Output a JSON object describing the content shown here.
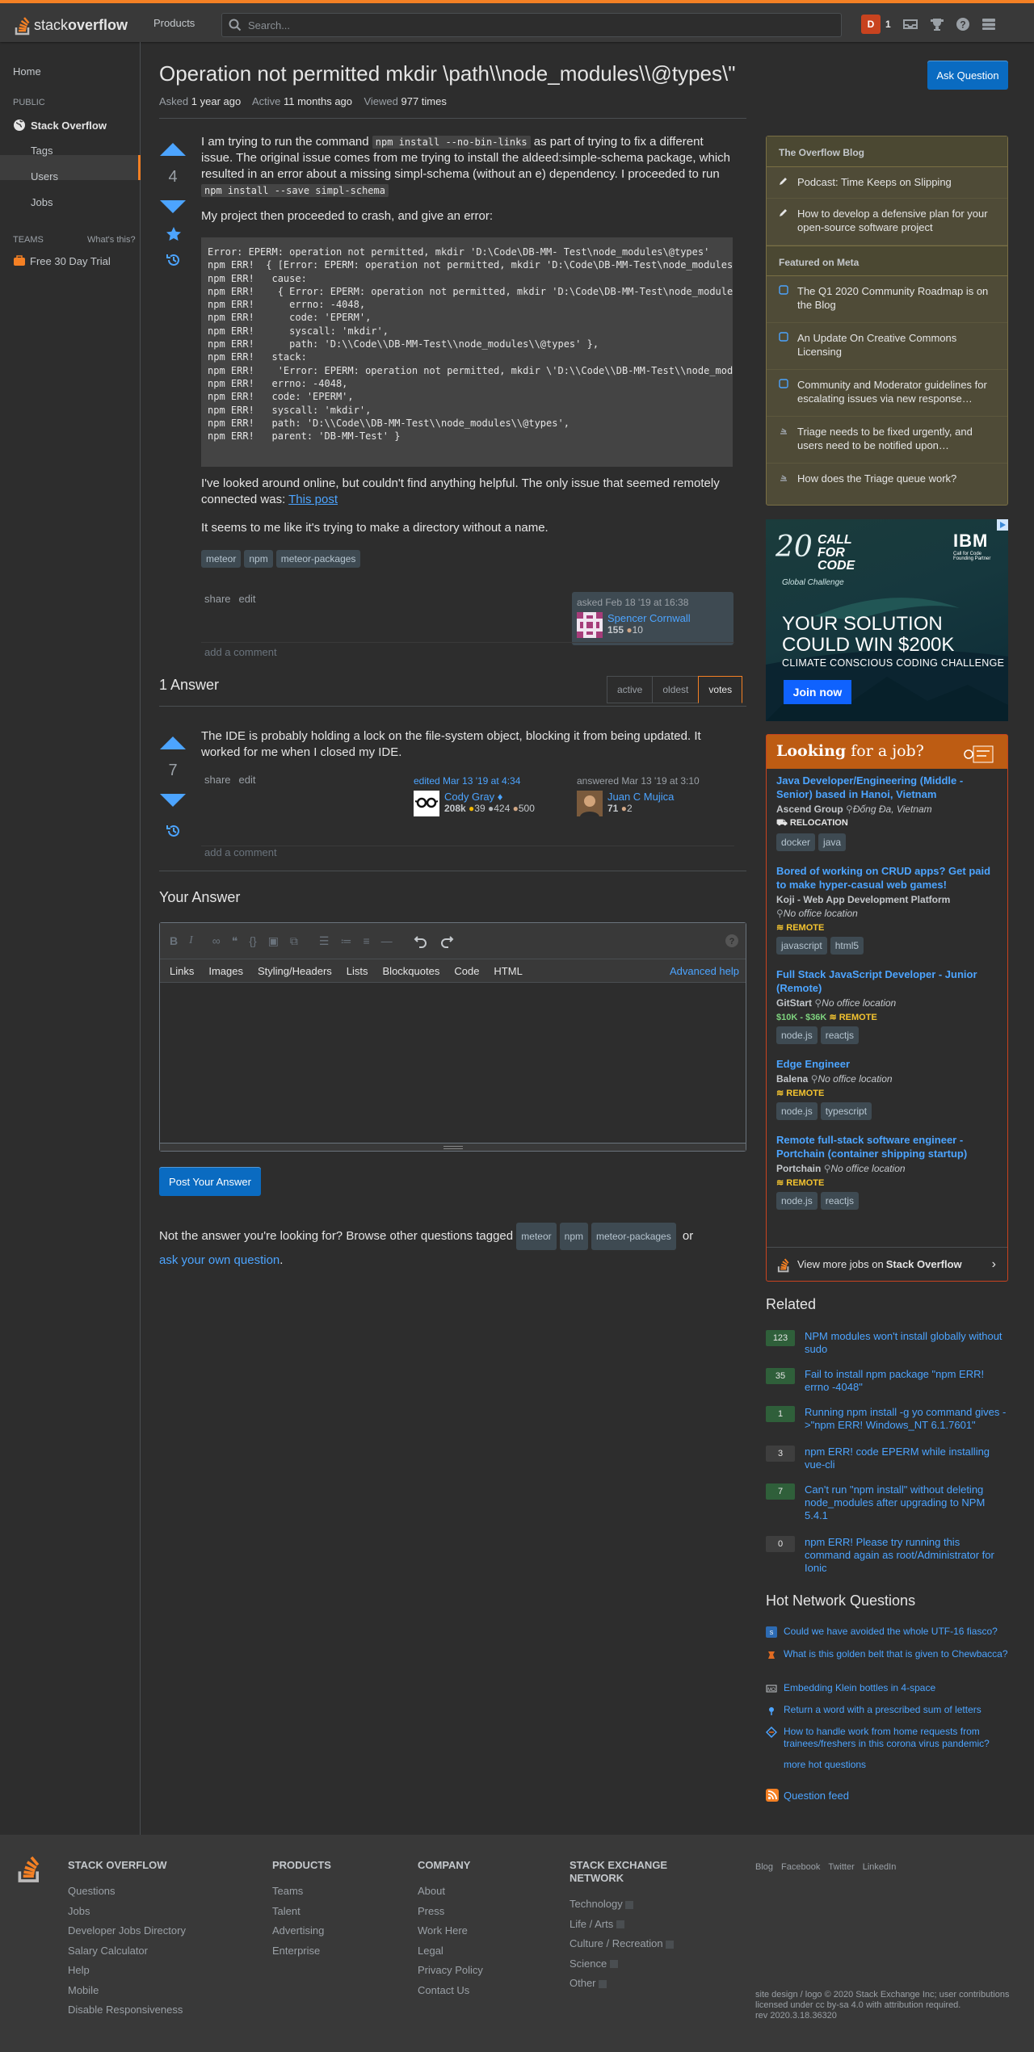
{
  "topbar": {
    "logo_text_light": "stack",
    "logo_text_bold": "overflow",
    "products": "Products",
    "search_placeholder": "Search...",
    "user_initial": "D",
    "rep": "1"
  },
  "sidebar": {
    "home": "Home",
    "public": "PUBLIC",
    "stackoverflow": "Stack Overflow",
    "tags": "Tags",
    "users": "Users",
    "jobs": "Jobs",
    "teams": "TEAMS",
    "whats_this": "What's this?",
    "free_trial": "Free 30 Day Trial"
  },
  "question": {
    "title": "Operation not permitted mkdir \\path\\\\node_modules\\\\@types\\\"",
    "ask_button": "Ask Question",
    "asked_label": "Asked",
    "asked_value": "1 year ago",
    "active_label": "Active",
    "active_value": "11 months ago",
    "viewed_label": "Viewed",
    "viewed_value": "977 times",
    "votes": "4",
    "p1_a": "I am trying to run the command ",
    "p1_code1": "npm install --no-bin-links",
    "p1_b": " as part of trying to fix a different issue. The original issue comes from me trying to install the aldeed:simple-schema package, which resulted in an error about a missing simpl-schema (without an e) dependency. I proceeded to run ",
    "p1_code2": "npm install --save simpl-schema",
    "p2": "My project then proceeded to crash, and give an error:",
    "code_block": "Error: EPERM: operation not permitted, mkdir 'D:\\Code\\DB-MM- Test\\node_modules\\@types'\nnpm ERR!  { [Error: EPERM: operation not permitted, mkdir 'D:\\Code\\DB-MM-Test\\node_modules\\\nnpm ERR!   cause:\nnpm ERR!    { Error: EPERM: operation not permitted, mkdir 'D:\\Code\\DB-MM-Test\\node_modules\nnpm ERR!      errno: -4048,\nnpm ERR!      code: 'EPERM',\nnpm ERR!      syscall: 'mkdir',\nnpm ERR!      path: 'D:\\\\Code\\\\DB-MM-Test\\\\node_modules\\\\@types' },\nnpm ERR!   stack:\nnpm ERR!    'Error: EPERM: operation not permitted, mkdir \\'D:\\\\Code\\\\DB-MM-Test\\\\node_modu\nnpm ERR!   errno: -4048,\nnpm ERR!   code: 'EPERM',\nnpm ERR!   syscall: 'mkdir',\nnpm ERR!   path: 'D:\\\\Code\\\\DB-MM-Test\\\\node_modules\\\\@types',\nnpm ERR!   parent: 'DB-MM-Test' }",
    "p3_a": "I've looked around online, but couldn't find anything helpful. The only issue that seemed remotely connected was: ",
    "p3_link": "This post",
    "p4": "It seems to me like it's trying to make a directory without a name.",
    "tags": [
      "meteor",
      "npm",
      "meteor-packages"
    ],
    "share": "share",
    "edit": "edit",
    "asked_card": "asked Feb 18 '19 at 16:38",
    "owner_name": "Spencer Cornwall",
    "owner_rep": "155",
    "owner_bronze": "10",
    "add_comment": "add a comment"
  },
  "answers": {
    "count_label": "1 Answer",
    "tabs": [
      "active",
      "oldest",
      "votes"
    ],
    "votes": "7",
    "body": "The IDE is probably holding a lock on the file-system object, blocking it from being updated. It worked for me when I closed my IDE.",
    "share": "share",
    "edit": "edit",
    "edited": "edited Mar 13 '19 at 4:34",
    "editor_name": "Cody Gray ♦",
    "editor_rep": "208k",
    "editor_gold": "39",
    "editor_silver": "424",
    "editor_bronze": "500",
    "answered": "answered Mar 13 '19 at 3:10",
    "answerer_name": "Juan C Mujica",
    "answerer_rep": "71",
    "answerer_bronze": "2",
    "add_comment": "add a comment"
  },
  "your_answer": {
    "heading": "Your Answer",
    "help_tabs": [
      "Links",
      "Images",
      "Styling/Headers",
      "Lists",
      "Blockquotes",
      "Code",
      "HTML"
    ],
    "advanced_help": "Advanced help",
    "post_button": "Post Your Answer",
    "not_answer_a": "Not the answer you're looking for? Browse other questions tagged ",
    "or": " or",
    "ask_own": "ask your own question",
    "period": "."
  },
  "blog": {
    "header1": "The Overflow Blog",
    "items1": [
      "Podcast: Time Keeps on Slipping",
      "How to develop a defensive plan for your open-source software project"
    ],
    "header2": "Featured on Meta",
    "items2": [
      "The Q1 2020 Community Roadmap is on the Blog",
      "An Update On Creative Commons Licensing",
      "Community and Moderator guidelines for escalating issues via new response…",
      "Triage needs to be fixed urgently, and users need to be notified upon…",
      "How does the Triage queue work?"
    ]
  },
  "ad": {
    "line1": "CALL",
    "line2": "FOR",
    "line3": "CODE",
    "line4": "Global Challenge",
    "brand": "IBM",
    "headline1": "YOUR SOLUTION",
    "headline2": "COULD WIN $200K",
    "sub": "CLIMATE CONSCIOUS CODING CHALLENGE",
    "cta": "Join now",
    "small": "Call for Code Founding Partner"
  },
  "jobs": {
    "header_bold": "Looking",
    "header_rest": " for a job?",
    "items": [
      {
        "title": "Java Developer/Engineering (Middle - Senior) based in Hanoi, Vietnam",
        "company": "Ascend Group",
        "location": "Đống Đa, Vietnam",
        "badge": "RELOCATION",
        "salary": "",
        "tags": [
          "docker",
          "java"
        ]
      },
      {
        "title": "Bored of working on CRUD apps? Get paid to make hyper-casual web games!",
        "company": "Koji - Web App Development Platform",
        "location": "No office location",
        "badge": "REMOTE",
        "salary": "",
        "tags": [
          "javascript",
          "html5"
        ]
      },
      {
        "title": "Full Stack JavaScript Developer - Junior (Remote)",
        "company": "GitStart",
        "location": "No office location",
        "badge": "REMOTE",
        "salary": "$10K - $36K",
        "tags": [
          "node.js",
          "reactjs"
        ]
      },
      {
        "title": "Edge Engineer",
        "company": "Balena",
        "location": "No office location",
        "badge": "REMOTE",
        "salary": "",
        "tags": [
          "node.js",
          "typescript"
        ]
      },
      {
        "title": "Remote full-stack software engineer - Portchain (container shipping startup)",
        "company": "Portchain",
        "location": "No office location",
        "badge": "REMOTE",
        "salary": "",
        "tags": [
          "node.js",
          "reactjs"
        ]
      }
    ],
    "view_more_a": "View more jobs on ",
    "view_more_b": "Stack Overflow"
  },
  "related": {
    "heading": "Related",
    "items": [
      {
        "count": "123",
        "answered": true,
        "text": "NPM modules won't install globally without sudo"
      },
      {
        "count": "35",
        "answered": true,
        "text": "Fail to install npm package \"npm ERR! errno -4048\""
      },
      {
        "count": "1",
        "answered": true,
        "text": "Running npm install -g yo command gives ->\"npm ERR! Windows_NT 6.1.7601\""
      },
      {
        "count": "3",
        "answered": false,
        "text": "npm ERR! code EPERM while installing vue-cli"
      },
      {
        "count": "7",
        "answered": true,
        "text": "Can't run \"npm install\" without deleting node_modules after upgrading to NPM 5.4.1"
      },
      {
        "count": "0",
        "answered": false,
        "text": "npm ERR! Please try running this command again as root/Administrator for Ionic"
      }
    ]
  },
  "hot": {
    "heading": "Hot Network Questions",
    "items": [
      "Could we have avoided the whole UTF-16 fiasco?",
      "What is this golden belt that is given to Chewbacca?",
      "Embedding Klein bottles in 4-space",
      "Return a word with a prescribed sum of letters",
      "How to handle work from home requests from trainees/freshers in this corona virus pandemic?"
    ],
    "more": "more hot questions",
    "feed": "Question feed"
  },
  "footer": {
    "col1_h": "STACK OVERFLOW",
    "col1": [
      "Questions",
      "Jobs",
      "Developer Jobs Directory",
      "Salary Calculator",
      "Help",
      "Mobile",
      "Disable Responsiveness"
    ],
    "col2_h": "PRODUCTS",
    "col2": [
      "Teams",
      "Talent",
      "Advertising",
      "Enterprise"
    ],
    "col3_h": "COMPANY",
    "col3": [
      "About",
      "Press",
      "Work Here",
      "Legal",
      "Privacy Policy",
      "Contact Us"
    ],
    "col4_h": "STACK EXCHANGE NETWORK",
    "col4": [
      "Technology",
      "Life / Arts",
      "Culture / Recreation",
      "Science",
      "Other"
    ],
    "social": [
      "Blog",
      "Facebook",
      "Twitter",
      "LinkedIn"
    ],
    "copyright": "site design / logo © 2020 Stack Exchange Inc; user contributions licensed under cc by-sa 4.0 with attribution required.",
    "rev": "rev 2020.3.18.36320"
  },
  "colors": {
    "accent": "#f48024",
    "link": "#4ca4ff",
    "primary_button": "#0a6bc1",
    "answered_badge": "#2f5f3a"
  }
}
